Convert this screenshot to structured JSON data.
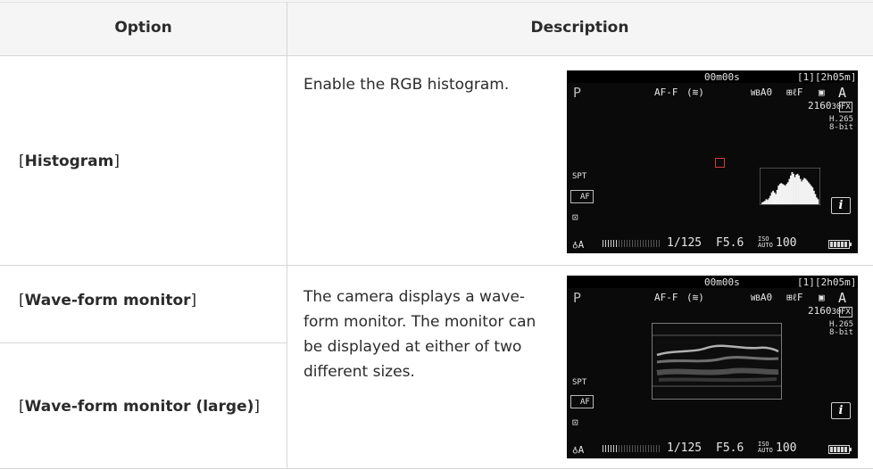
{
  "table": {
    "header": {
      "option": "Option",
      "description": "Description"
    },
    "rows": [
      {
        "option_prefix": "[",
        "option_bold": "Histogram",
        "option_suffix": "]",
        "description": "Enable the RGB histogram."
      },
      {
        "option_prefix": "[",
        "option_bold": "Wave-form monitor",
        "option_suffix": "]",
        "description": "The camera displays a wave-form monitor. The monitor can be displayed at either of two different sizes."
      },
      {
        "option_prefix": "[",
        "option_bold": "Wave-form monitor (large)",
        "option_suffix": "]"
      }
    ]
  },
  "screens": [
    {
      "timecode": "00m00s",
      "remaining": "2h05m",
      "mode": "P",
      "af_mode": "AF-F",
      "wb": "A0",
      "res": "2160",
      "fps": "30",
      "fx": "FX",
      "codec": "H.265",
      "bitdepth": "8-bit",
      "spt": "SPT",
      "af_area": "AF",
      "i_button": "i",
      "mic": "A",
      "shutter": "1/125",
      "aperture": "F5.6",
      "iso_label": "ISO AUTO",
      "iso": "100",
      "histogram": [
        2,
        3,
        4,
        6,
        5,
        7,
        10,
        14,
        16,
        14,
        12,
        17,
        22,
        24,
        25,
        24,
        23,
        22,
        24,
        26,
        30,
        34,
        38,
        36,
        32,
        35,
        36,
        34,
        30,
        27,
        29,
        31,
        30,
        28,
        26,
        24,
        22,
        20,
        16,
        12,
        8,
        6
      ]
    },
    {
      "timecode": "00m00s",
      "remaining": "2h05m",
      "mode": "P",
      "af_mode": "AF-F",
      "wb": "A0",
      "res": "2160",
      "fps": "30",
      "fx": "FX",
      "codec": "H.265",
      "bitdepth": "8-bit",
      "spt": "SPT",
      "af_area": "AF",
      "i_button": "i",
      "mic": "A",
      "shutter": "1/125",
      "aperture": "F5.6",
      "iso_label": "ISO AUTO",
      "iso": "100"
    }
  ]
}
